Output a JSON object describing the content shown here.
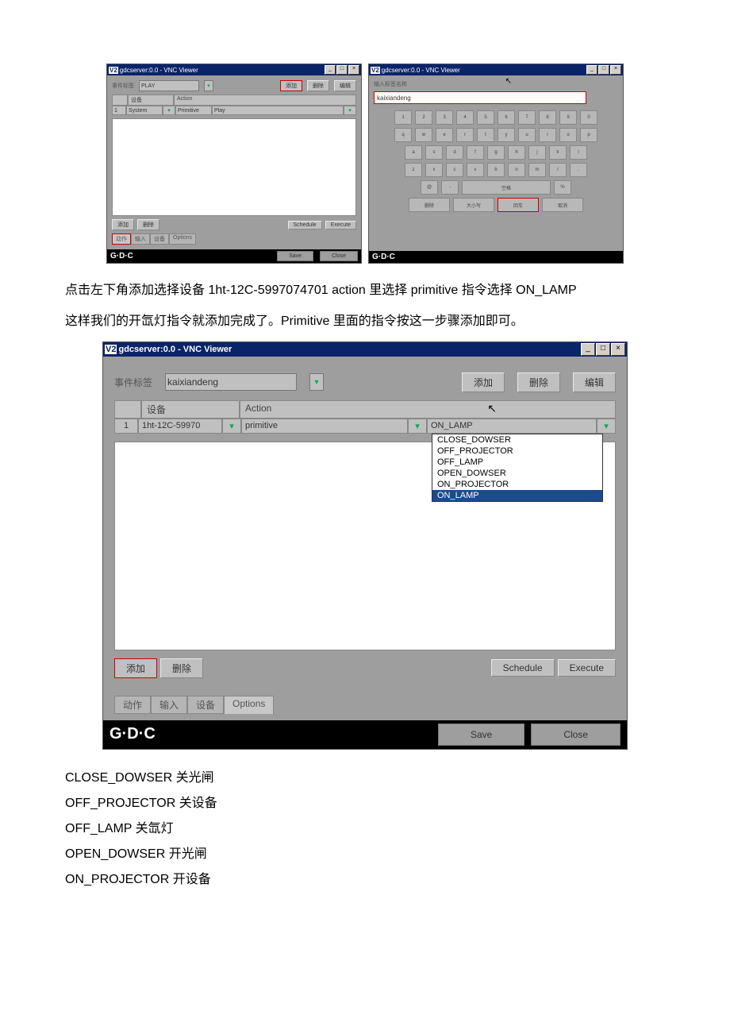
{
  "vnc_title": "gdcserver:0.0 - VNC Viewer",
  "small_left": {
    "event_label": "事件标签",
    "event_value": "PLAY",
    "btn_add": "添加",
    "btn_del": "删除",
    "btn_edit": "编辑",
    "col_device": "设备",
    "col_action": "Action",
    "row_num": "1",
    "row_device": "System",
    "row_action_type": "Primitive",
    "row_action_val": "Play",
    "btn_add2": "添加",
    "btn_del2": "删除",
    "btn_schedule": "Schedule",
    "btn_execute": "Execute",
    "tab_action": "动作",
    "tab_input": "输入",
    "tab_device": "设备",
    "tab_options": "Options",
    "btn_save": "Save",
    "btn_close": "Close"
  },
  "small_right": {
    "hint": "输入标签名称",
    "input_value": "kaixiandeng",
    "keys_row1": [
      "1",
      "2",
      "3",
      "4",
      "5",
      "6",
      "7",
      "8",
      "9",
      "0"
    ],
    "keys_row2": [
      "q",
      "w",
      "e",
      "r",
      "t",
      "y",
      "u",
      "i",
      "o",
      "p"
    ],
    "keys_row3": [
      "a",
      "s",
      "d",
      "f",
      "g",
      "h",
      "j",
      "k",
      "l"
    ],
    "keys_row4": [
      "z",
      "x",
      "c",
      "v",
      "b",
      "n",
      "m",
      "/",
      "."
    ],
    "key_at": "@",
    "key_dash": "-",
    "key_space": "空格",
    "key_pct": "%",
    "btn_del": "删除",
    "btn_case": "大小写",
    "btn_enter": "回车",
    "btn_cancel": "取消"
  },
  "para1": "点击左下角添加选择设备 1ht-12C-5997074701 action 里选择 primitive 指令选择 ON_LAMP",
  "para2": "这样我们的开氙灯指令就添加完成了。Primitive 里面的指令按这一步骤添加即可。",
  "large": {
    "event_label": "事件标签",
    "event_value": "kaixiandeng",
    "btn_add": "添加",
    "btn_del": "删除",
    "btn_edit": "编辑",
    "col_device": "设备",
    "col_action": "Action",
    "row_num": "1",
    "row_device": "1ht-12C-59970",
    "row_action_type": "primitive",
    "selected_cmd": "ON_LAMP",
    "dropdown_items": [
      "CLOSE_DOWSER",
      "OFF_PROJECTOR",
      "OFF_LAMP",
      "OPEN_DOWSER",
      "ON_PROJECTOR",
      "ON_LAMP"
    ],
    "btn_add2": "添加",
    "btn_del2": "删除",
    "btn_schedule": "Schedule",
    "btn_execute": "Execute",
    "tab_action": "动作",
    "tab_input": "输入",
    "tab_device": "设备",
    "tab_options": "Options",
    "btn_save": "Save",
    "btn_close": "Close"
  },
  "logo": "G·D·C",
  "defs": [
    {
      "cmd": "CLOSE_DOWSER",
      "zh": " 关光闸"
    },
    {
      "cmd": "OFF_PROJECTOR",
      "zh": " 关设备"
    },
    {
      "cmd": "OFF_LAMP",
      "zh": " 关氙灯"
    },
    {
      "cmd": "OPEN_DOWSER",
      "zh": " 开光闸"
    },
    {
      "cmd": "ON_PROJECTOR",
      "zh": " 开设备"
    }
  ]
}
